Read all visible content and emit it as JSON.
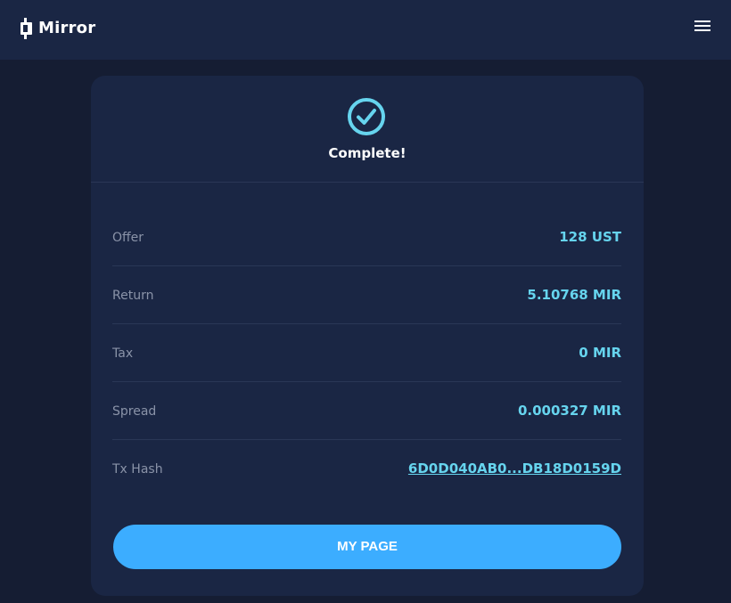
{
  "app": {
    "name": "Mirror",
    "logo_icon": "mirror-logo-icon",
    "menu_icon": "hamburger-menu-icon"
  },
  "colors": {
    "background": "#151d33",
    "surface": "#1a2644",
    "accent": "#66d4ee",
    "button": "#3cadff",
    "label": "#8a93a8"
  },
  "result": {
    "icon": "check-circle-icon",
    "title": "Complete!"
  },
  "details": [
    {
      "label": "Offer",
      "value": "128 UST"
    },
    {
      "label": "Return",
      "value": "5.10768 MIR"
    },
    {
      "label": "Tax",
      "value": "0 MIR"
    },
    {
      "label": "Spread",
      "value": "0.000327 MIR"
    },
    {
      "label": "Tx Hash",
      "value": "6D0D040AB0...DB18D0159D"
    }
  ],
  "actions": {
    "primary_label": "MY PAGE"
  }
}
